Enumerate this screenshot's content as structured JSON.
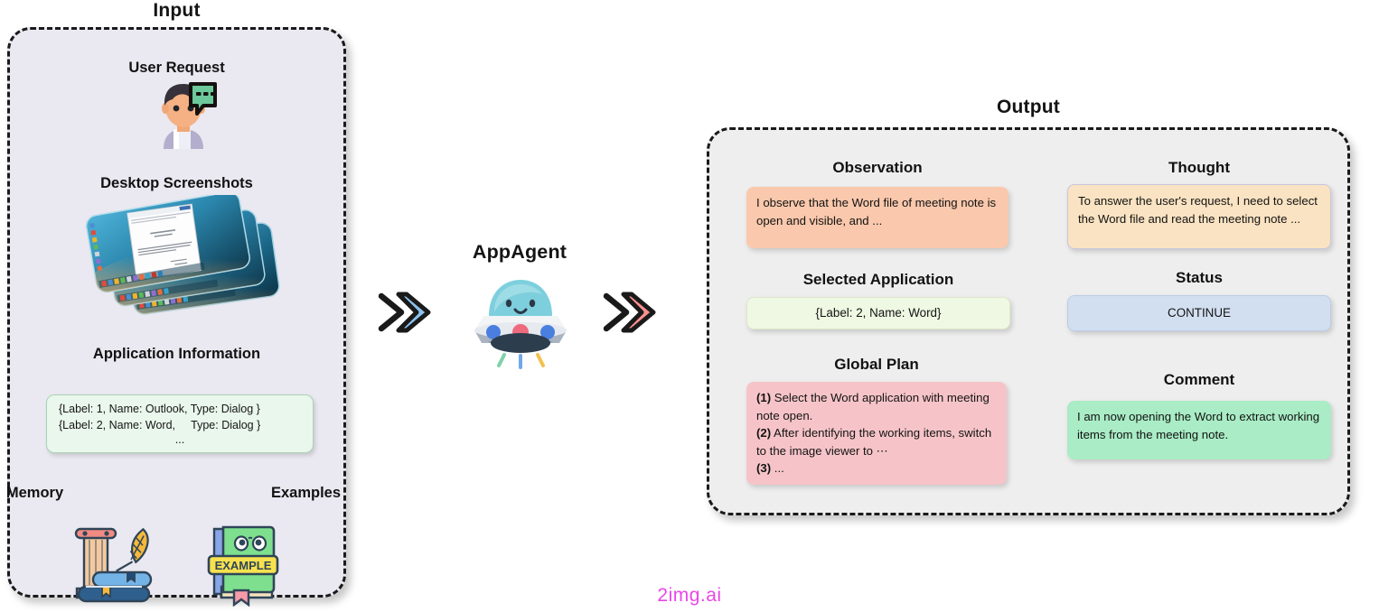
{
  "captions": {
    "input": "Input",
    "output": "Output"
  },
  "input": {
    "user_request": {
      "title": "User Request",
      "icon": "user-with-speech-bubble-icon"
    },
    "desktop_screenshots": {
      "title": "Desktop Screenshots",
      "icon": "stacked-desktop-screenshots-icon"
    },
    "application_information": {
      "title": "Application Information",
      "lines": [
        "{Label: 1, Name: Outlook, Type: Dialog }",
        "{Label: 2, Name: Word,     Type: Dialog }"
      ],
      "ellipsis": "..."
    },
    "memory": {
      "title": "Memory",
      "icon": "pillar-books-quill-icon"
    },
    "examples": {
      "title": "Examples",
      "icon": "example-book-icon",
      "book_label": "EXAMPLE"
    }
  },
  "center": {
    "agent_label": "AppAgent",
    "agent_icon": "ufo-robot-icon",
    "arrow_in": {
      "name": "double-chevron-right-blue-icon",
      "color": "#8ec2ee"
    },
    "arrow_out": {
      "name": "double-chevron-right-red-icon",
      "color": "#f9918f"
    }
  },
  "output": {
    "observation": {
      "heading": "Observation",
      "text": "I observe that the Word file of meeting note is open and visible, and ...",
      "color": "#fac8ac"
    },
    "thought": {
      "heading": "Thought",
      "text": "To answer the user's request, I need to select the Word file and read the meeting note ...",
      "color": "#fae3c2"
    },
    "selected_application": {
      "heading": "Selected Application",
      "text": "{Label: 2, Name: Word}",
      "color": "#eef8e2"
    },
    "status": {
      "heading": "Status",
      "text": "CONTINUE",
      "color": "#d2dff0"
    },
    "global_plan": {
      "heading": "Global Plan",
      "color": "#f6c4c8",
      "steps": [
        {
          "num": "(1)",
          "text": " Select the Word application with meeting note open."
        },
        {
          "num": "(2)",
          "text": " After identifying the working items, switch to the image viewer to ⋯"
        },
        {
          "num": "(3)",
          "text": " ..."
        }
      ]
    },
    "comment": {
      "heading": "Comment",
      "text": "I am now opening the Word to extract working items from the meeting note.",
      "color": "#a9ecc5"
    }
  },
  "watermark": "2img.ai"
}
